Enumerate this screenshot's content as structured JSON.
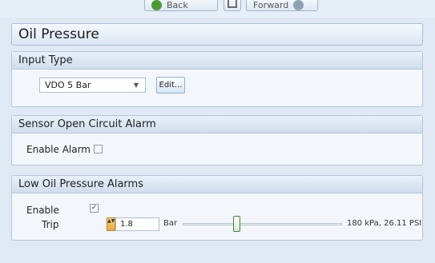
{
  "nav": {
    "back_label": "Back",
    "forward_label": "Forward"
  },
  "page_title": "Oil Pressure",
  "input_type": {
    "header": "Input Type",
    "selected_sensor": "VDO 5 Bar",
    "edit_label": "Edit..."
  },
  "sensor_open": {
    "header": "Sensor Open Circuit Alarm",
    "enable_label": "Enable Alarm",
    "enabled": false
  },
  "low_oil": {
    "header": "Low Oil Pressure Alarms",
    "enable_label": "Enable",
    "enabled": true,
    "enabled_mark": "✓",
    "trip_label": "Trip",
    "trip_value": "1.8",
    "trip_unit": "Bar",
    "trip_readout": "180 kPa, 26.11 PSI",
    "spinner_glyph": "▲▼"
  }
}
